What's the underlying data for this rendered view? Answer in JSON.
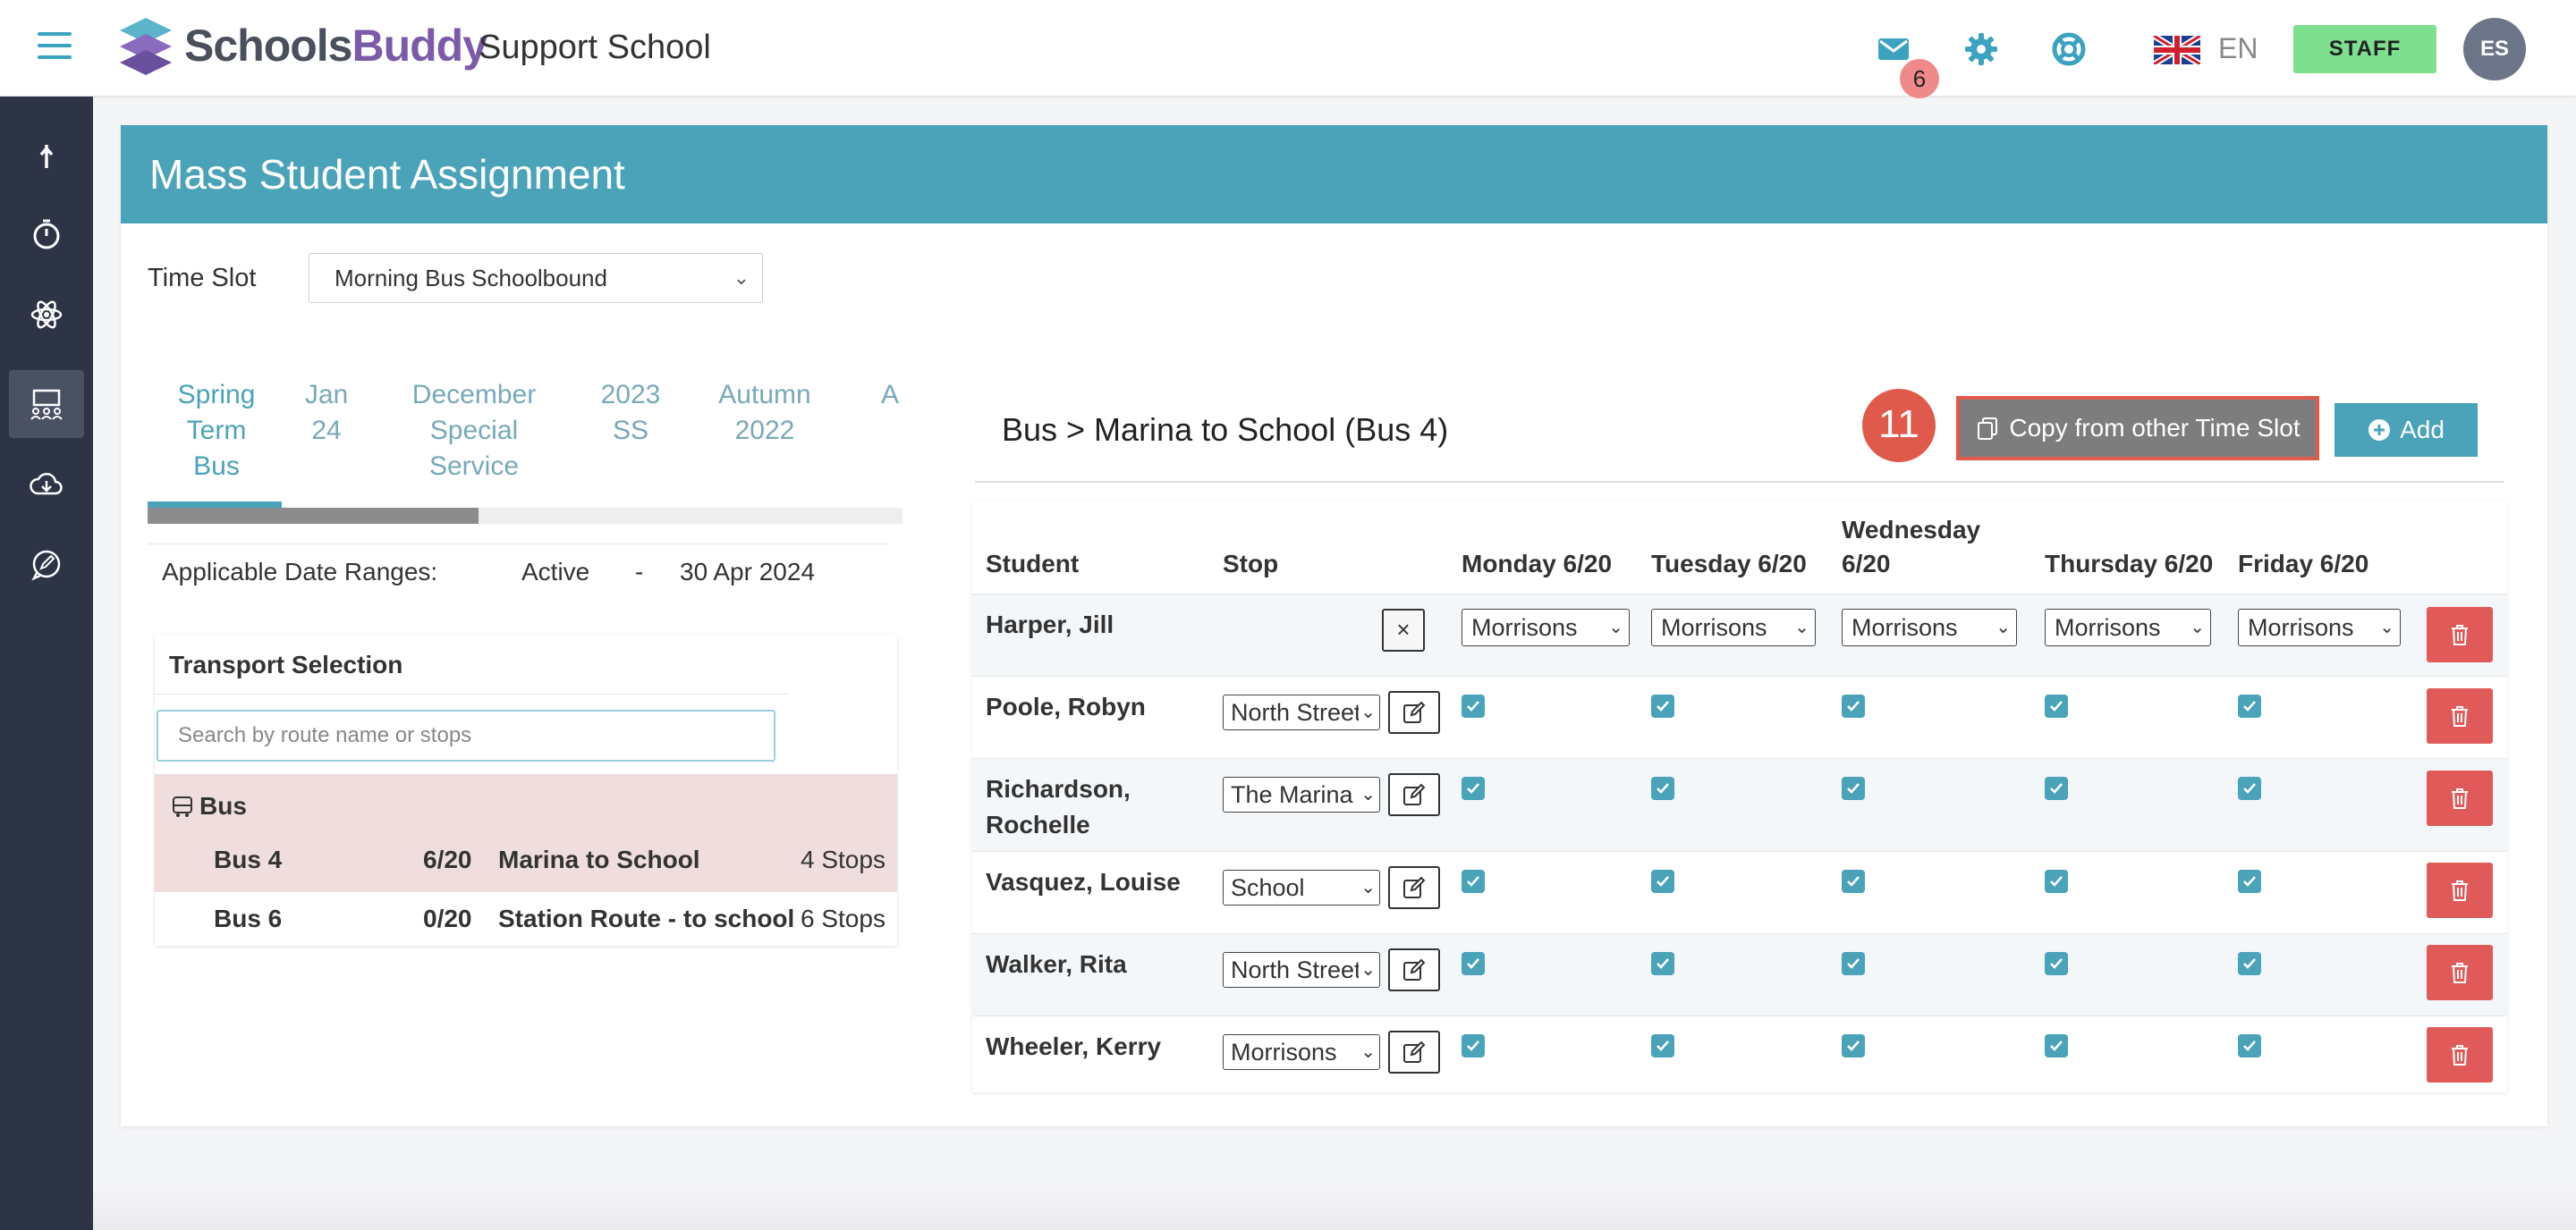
{
  "header": {
    "logo_part1": "Schools",
    "logo_part2": "Buddy",
    "school_name": "Support School",
    "mail_badge": "6",
    "language": "EN",
    "staff_label": "STAFF",
    "avatar_initials": "ES"
  },
  "panel": {
    "title": "Mass Student Assignment",
    "time_slot_label": "Time Slot",
    "time_slot_value": "Morning Bus Schoolbound"
  },
  "tabs": [
    {
      "lines": [
        "Spring",
        "Term",
        "Bus"
      ]
    },
    {
      "lines": [
        "Jan",
        "24"
      ]
    },
    {
      "lines": [
        "December",
        "Special",
        "Service"
      ]
    },
    {
      "lines": [
        "2023",
        "SS"
      ]
    },
    {
      "lines": [
        "Autumn",
        "2022"
      ]
    },
    {
      "lines": [
        "A"
      ]
    }
  ],
  "date_ranges": {
    "label": "Applicable Date Ranges:",
    "status": "Active",
    "dash": "-",
    "end": "30 Apr 2024"
  },
  "transport": {
    "title": "Transport Selection",
    "search_placeholder": "Search by route name or stops",
    "group_label": "Bus",
    "routes": [
      {
        "bus": "Bus 4",
        "capacity": "6/20",
        "name": "Marina to School",
        "stops": "4 Stops"
      },
      {
        "bus": "Bus 6",
        "capacity": "0/20",
        "name": "Station Route - to school",
        "stops": "6 Stops"
      }
    ]
  },
  "assignment": {
    "title": "Bus > Marina to School (Bus 4)",
    "step_number": "11",
    "copy_label": "Copy from other Time Slot",
    "add_label": "Add",
    "columns": {
      "student": "Student",
      "stop": "Stop",
      "mon": "Monday 6/20",
      "tue": "Tuesday 6/20",
      "wed_1": "Wednesday",
      "wed_2": "6/20",
      "thu": "Thursday 6/20",
      "fri": "Friday 6/20"
    },
    "first_row": {
      "student": "Harper, Jill",
      "clear": "×",
      "days": [
        "Morrisons",
        "Morrisons",
        "Morrisons",
        "Morrisons",
        "Morrisons"
      ]
    },
    "rows": [
      {
        "student_1": "Poole, Robyn",
        "student_2": "",
        "stop": "North Street"
      },
      {
        "student_1": "Richardson,",
        "student_2": "Rochelle",
        "stop": "The Marina"
      },
      {
        "student_1": "Vasquez, Louise",
        "student_2": "",
        "stop": "School"
      },
      {
        "student_1": "Walker, Rita",
        "student_2": "",
        "stop": "North Street"
      },
      {
        "student_1": "Wheeler, Kerry",
        "student_2": "",
        "stop": "Morrisons"
      }
    ]
  },
  "colors": {
    "accent": "#4aa3b8",
    "sidebar": "#2d3446",
    "danger": "#e05a5a",
    "staff": "#7ee08f",
    "highlight": "#e05a4b"
  }
}
